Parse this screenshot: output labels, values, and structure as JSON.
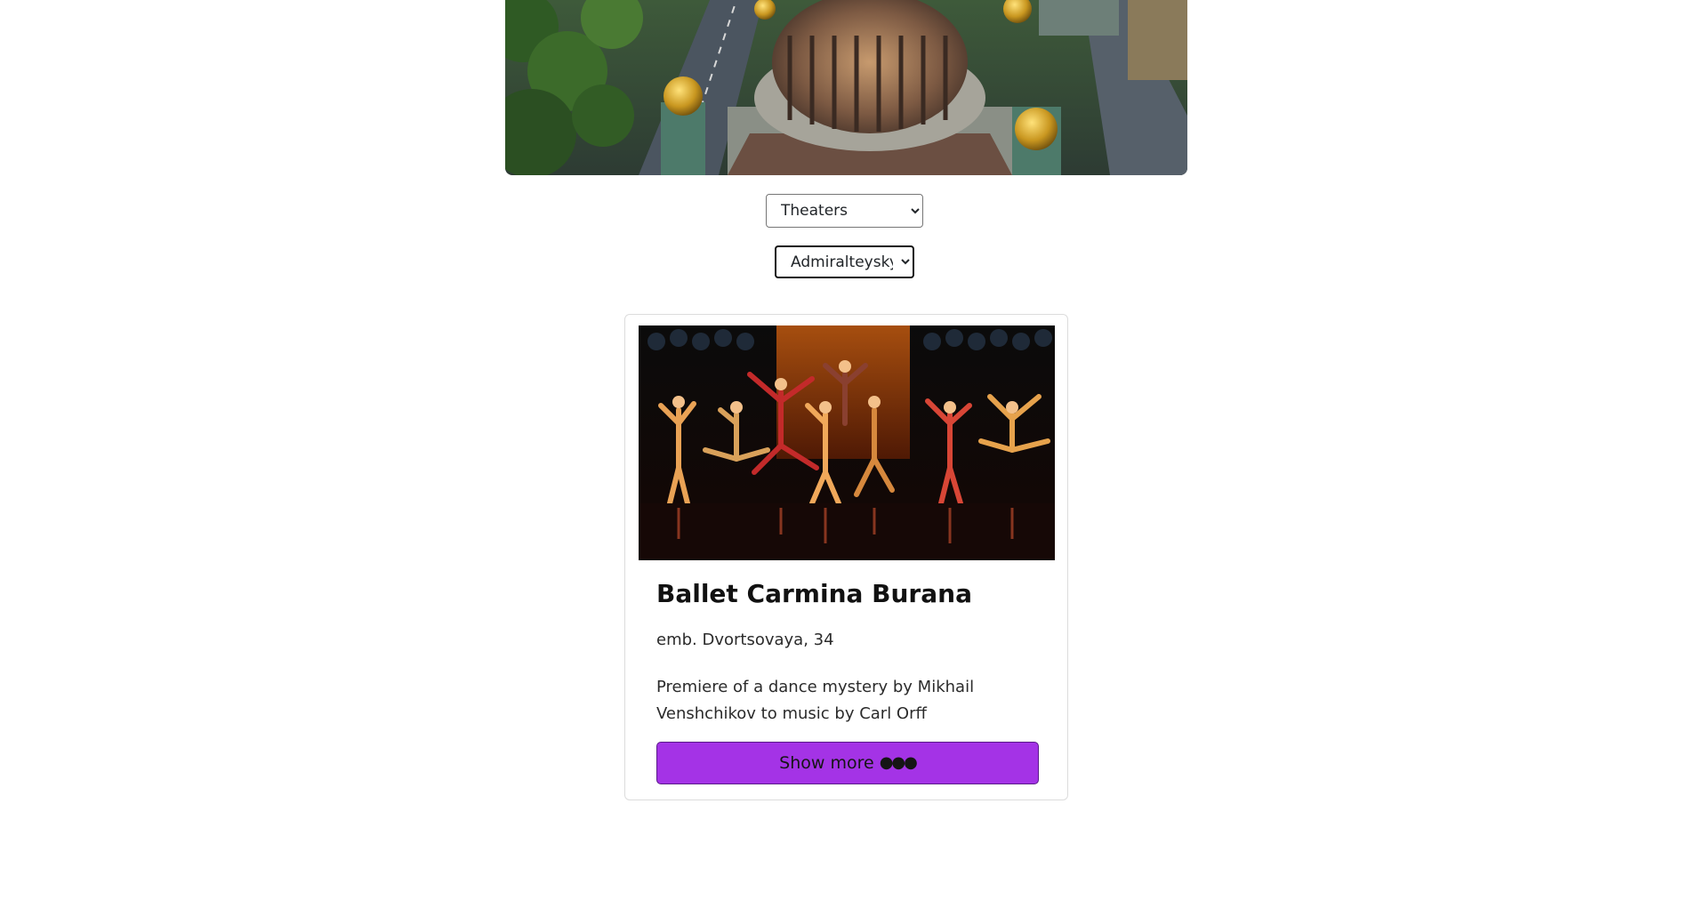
{
  "hero": {
    "image": "aerial-cathedral-photo"
  },
  "filters": {
    "category": {
      "selected": "Theaters",
      "options": [
        "Theaters"
      ]
    },
    "district": {
      "selected": "Admiralteysky",
      "options": [
        "Admiralteysky"
      ]
    }
  },
  "event_card": {
    "image": "ballet-dancers-photo",
    "title": "Ballet Carmina Burana",
    "address": "emb. Dvortsovaya, 34",
    "description": "Premiere of a dance mystery by Mikhail Venshchikov to music by Carl Orff",
    "button_label": "Show more",
    "button_icon": "ellipsis-icon",
    "button_color": "#a433e6"
  }
}
